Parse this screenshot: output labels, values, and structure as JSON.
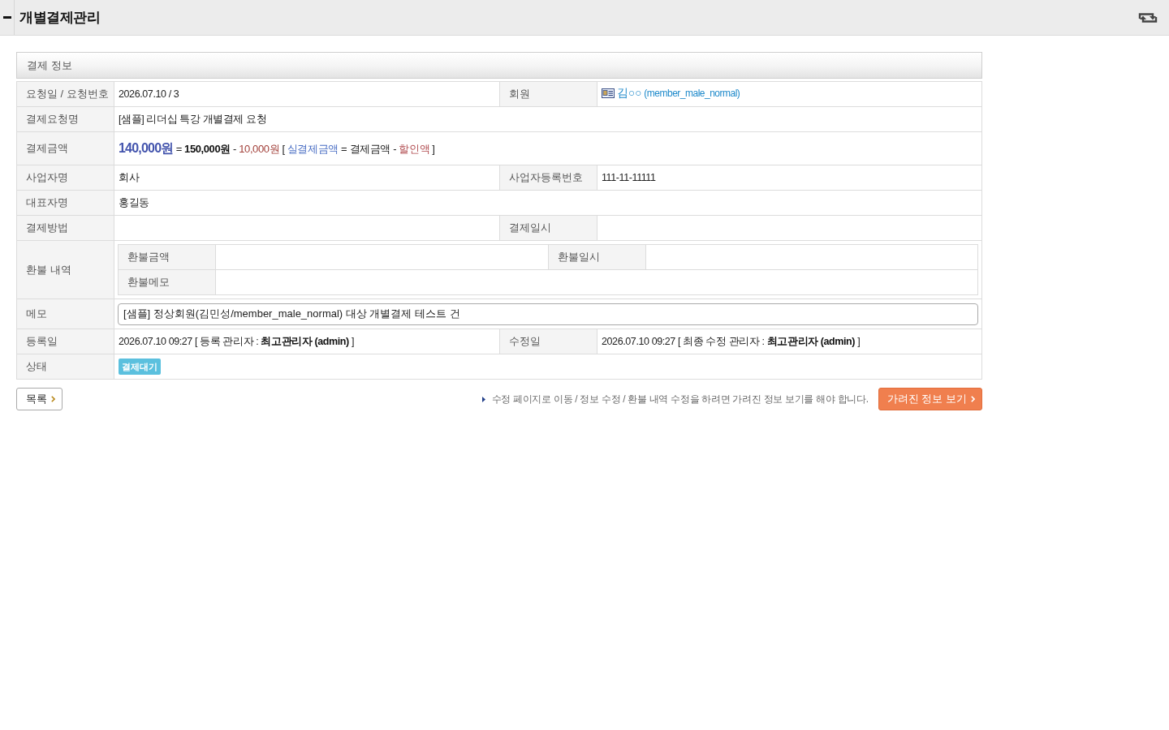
{
  "page_header": {
    "title": "개별결제관리"
  },
  "section": {
    "title": "결제 정보"
  },
  "rows": [
    {
      "kind": "split",
      "fields": [
        {
          "label": "요청일 / 요청번호",
          "value": "2026.07.10 / 3"
        },
        {
          "label": "회원",
          "member": {
            "name": "김○○",
            "user_id": "(member_male_normal)"
          }
        }
      ]
    },
    {
      "kind": "wide",
      "fields": [
        {
          "label": "결제요청명",
          "value": "[샘플] 리더십 특강 개별결제 요청"
        }
      ]
    },
    {
      "kind": "formula",
      "fields": [
        {
          "label": "결제금액",
          "parts": [
            {
              "kind": "final",
              "text": "140,000원"
            },
            {
              "kind": "op",
              "text": "="
            },
            {
              "kind": "price",
              "text": "150,000원"
            },
            {
              "kind": "op",
              "text": "-"
            },
            {
              "kind": "discount",
              "text": "10,000원"
            },
            {
              "kind": "op",
              "text": "["
            },
            {
              "kind": "final_label",
              "text": "실결제금액"
            },
            {
              "kind": "op",
              "text": "="
            },
            {
              "kind": "plain",
              "text": "결제금액"
            },
            {
              "kind": "op",
              "text": "-"
            },
            {
              "kind": "discount_label",
              "text": "할인액"
            },
            {
              "kind": "op",
              "text": "]"
            }
          ]
        }
      ]
    },
    {
      "kind": "split",
      "fields": [
        {
          "label": "사업자명",
          "value": "회사"
        },
        {
          "label": "사업자등록번호",
          "value": "111-11-11111"
        }
      ]
    },
    {
      "kind": "wide",
      "fields": [
        {
          "label": "대표자명",
          "value": "홍길동"
        }
      ]
    },
    {
      "kind": "split",
      "fields": [
        {
          "label": "결제방법"
        },
        {
          "label": "결제일시"
        }
      ]
    },
    {
      "kind": "refund",
      "fields": [
        {
          "label": "환불 내역",
          "rows": [
            [
              {
                "label": "환불금액"
              },
              {
                "label": "환불일시"
              }
            ],
            [
              {
                "label": "환불메모"
              }
            ]
          ]
        }
      ]
    },
    {
      "kind": "memo",
      "fields": [
        {
          "label": "메모",
          "input": "[샘플] 정상회원(김민성/member_male_normal) 대상 개별결제 테스트 건"
        }
      ]
    },
    {
      "kind": "split",
      "fields": [
        {
          "label": "등록일",
          "value": "2026.07.10 09:27 [ 등록 관리자 : **최고관리자 (admin)** ]"
        },
        {
          "label": "수정일",
          "value": "2026.07.10 09:27 [ 최종 수정 관리자 : **최고관리자 (admin)** ]"
        }
      ]
    },
    {
      "kind": "status",
      "fields": [
        {
          "label": "상태",
          "badge": "결제대기"
        }
      ]
    }
  ],
  "footer": {
    "list_button": "목록",
    "hint": "수정 페이지로 이동 / 정보 수정 / 환불 내역 수정을 하려면 가려진 정보 보기를 해야 합니다.",
    "reveal_button": "가려진 정보 보기"
  }
}
